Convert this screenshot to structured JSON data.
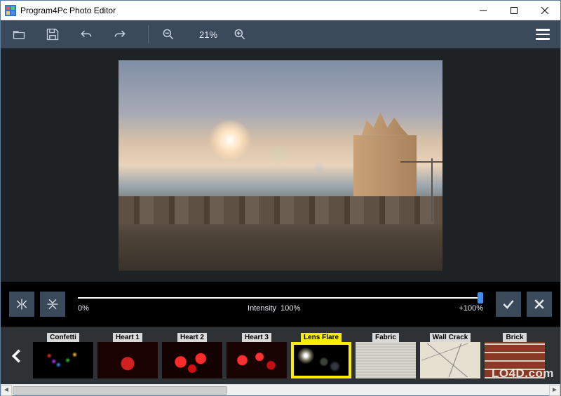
{
  "window": {
    "title": "Program4Pc Photo Editor"
  },
  "toolbar": {
    "zoomLevel": "21%"
  },
  "effectControls": {
    "minLabel": "0%",
    "paramLabel": "Intensity",
    "paramValue": "100%",
    "maxLabel": "+100%",
    "sliderPercent": 100
  },
  "effects": {
    "items": [
      {
        "label": "Confetti",
        "thumbClass": "tv-confetti",
        "selected": false
      },
      {
        "label": "Heart 1",
        "thumbClass": "tv-heart1",
        "selected": false
      },
      {
        "label": "Heart 2",
        "thumbClass": "tv-heart2",
        "selected": false
      },
      {
        "label": "Heart 3",
        "thumbClass": "tv-heart3",
        "selected": false
      },
      {
        "label": "Lens Flare",
        "thumbClass": "tv-lensflare",
        "selected": true
      },
      {
        "label": "Fabric",
        "thumbClass": "tv-fabric",
        "selected": false
      },
      {
        "label": "Wall Crack",
        "thumbClass": "tv-wallcrack",
        "selected": false
      },
      {
        "label": "Brick",
        "thumbClass": "tv-brick",
        "selected": false
      }
    ]
  },
  "watermark": "LO4D.com"
}
